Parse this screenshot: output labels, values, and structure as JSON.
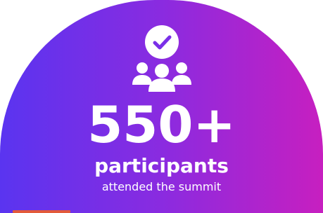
{
  "stat": {
    "number": "550+",
    "label": "participants",
    "sub": "attended the summit"
  },
  "icons": {
    "top": "check-circle-icon",
    "people": "group-users-icon"
  },
  "colors": {
    "gradient_start": "#5a34f0",
    "gradient_mid": "#8a2be0",
    "gradient_end": "#c71fc0",
    "text": "#ffffff",
    "accent": "#e25a3b"
  }
}
